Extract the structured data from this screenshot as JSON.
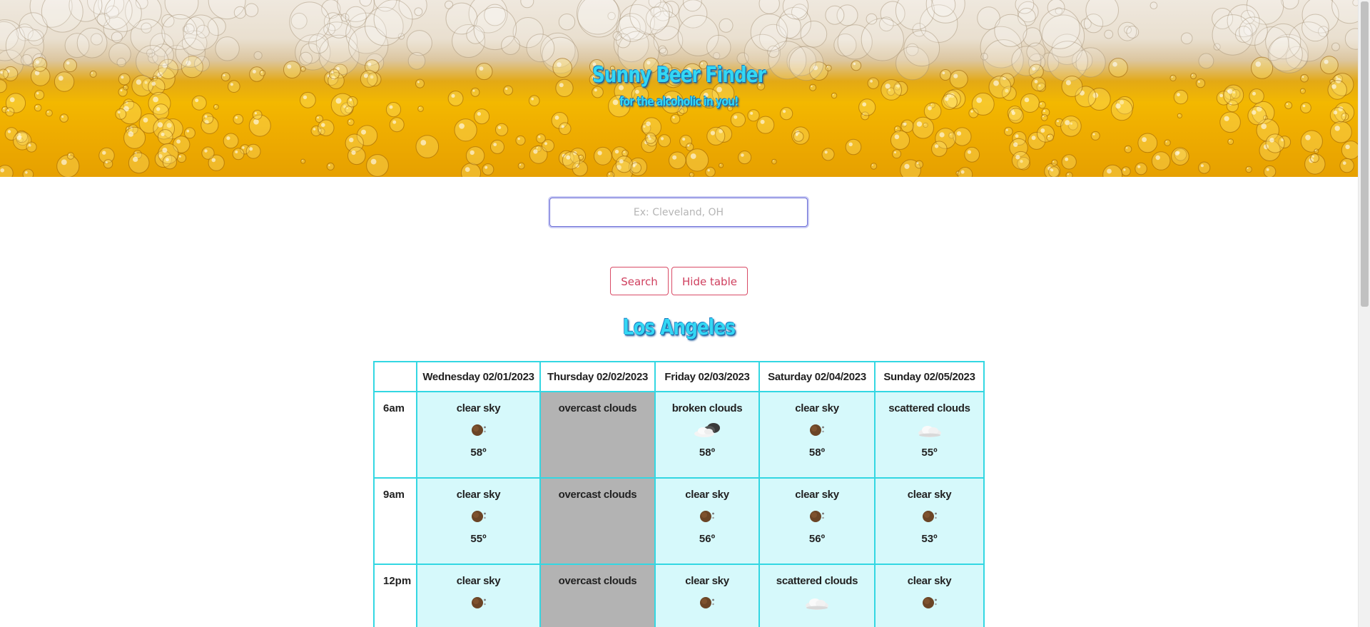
{
  "header": {
    "title": "Sunny Beer Finder",
    "subtitle": "for the alcoholic in you!"
  },
  "search": {
    "placeholder": "Ex: Cleveland, OH",
    "value": "",
    "search_label": "Search",
    "hide_label": "Hide table"
  },
  "city": "Los Angeles",
  "table": {
    "columns": [
      "Wednesday 02/01/2023",
      "Thursday 02/02/2023",
      "Friday 02/03/2023",
      "Saturday 02/04/2023",
      "Sunday 02/05/2023"
    ],
    "rows": [
      {
        "time": "6am",
        "cells": [
          {
            "desc": "clear sky",
            "icon": "clear-sky-icon",
            "temp": "58º"
          },
          {
            "desc": "overcast clouds",
            "icon": "",
            "temp": ""
          },
          {
            "desc": "broken clouds",
            "icon": "broken-clouds-icon",
            "temp": "58º"
          },
          {
            "desc": "clear sky",
            "icon": "clear-sky-icon",
            "temp": "58º"
          },
          {
            "desc": "scattered clouds",
            "icon": "scattered-clouds-icon",
            "temp": "55º"
          }
        ]
      },
      {
        "time": "9am",
        "cells": [
          {
            "desc": "clear sky",
            "icon": "clear-sky-icon",
            "temp": "55º"
          },
          {
            "desc": "overcast clouds",
            "icon": "",
            "temp": ""
          },
          {
            "desc": "clear sky",
            "icon": "clear-sky-icon",
            "temp": "56º"
          },
          {
            "desc": "clear sky",
            "icon": "clear-sky-icon",
            "temp": "56º"
          },
          {
            "desc": "clear sky",
            "icon": "clear-sky-icon",
            "temp": "53º"
          }
        ]
      },
      {
        "time": "12pm",
        "cells": [
          {
            "desc": "clear sky",
            "icon": "clear-sky-icon",
            "temp": ""
          },
          {
            "desc": "overcast clouds",
            "icon": "",
            "temp": ""
          },
          {
            "desc": "clear sky",
            "icon": "clear-sky-icon",
            "temp": ""
          },
          {
            "desc": "scattered clouds",
            "icon": "scattered-clouds-icon",
            "temp": ""
          },
          {
            "desc": "clear sky",
            "icon": "clear-sky-icon",
            "temp": ""
          }
        ]
      }
    ]
  },
  "colors": {
    "title": "#33d7f4",
    "table_border": "#33d7e2",
    "cell_bg": "#d6f9fb",
    "overcast_bg": "#b3b3b3",
    "button": "#cf3f5e"
  }
}
